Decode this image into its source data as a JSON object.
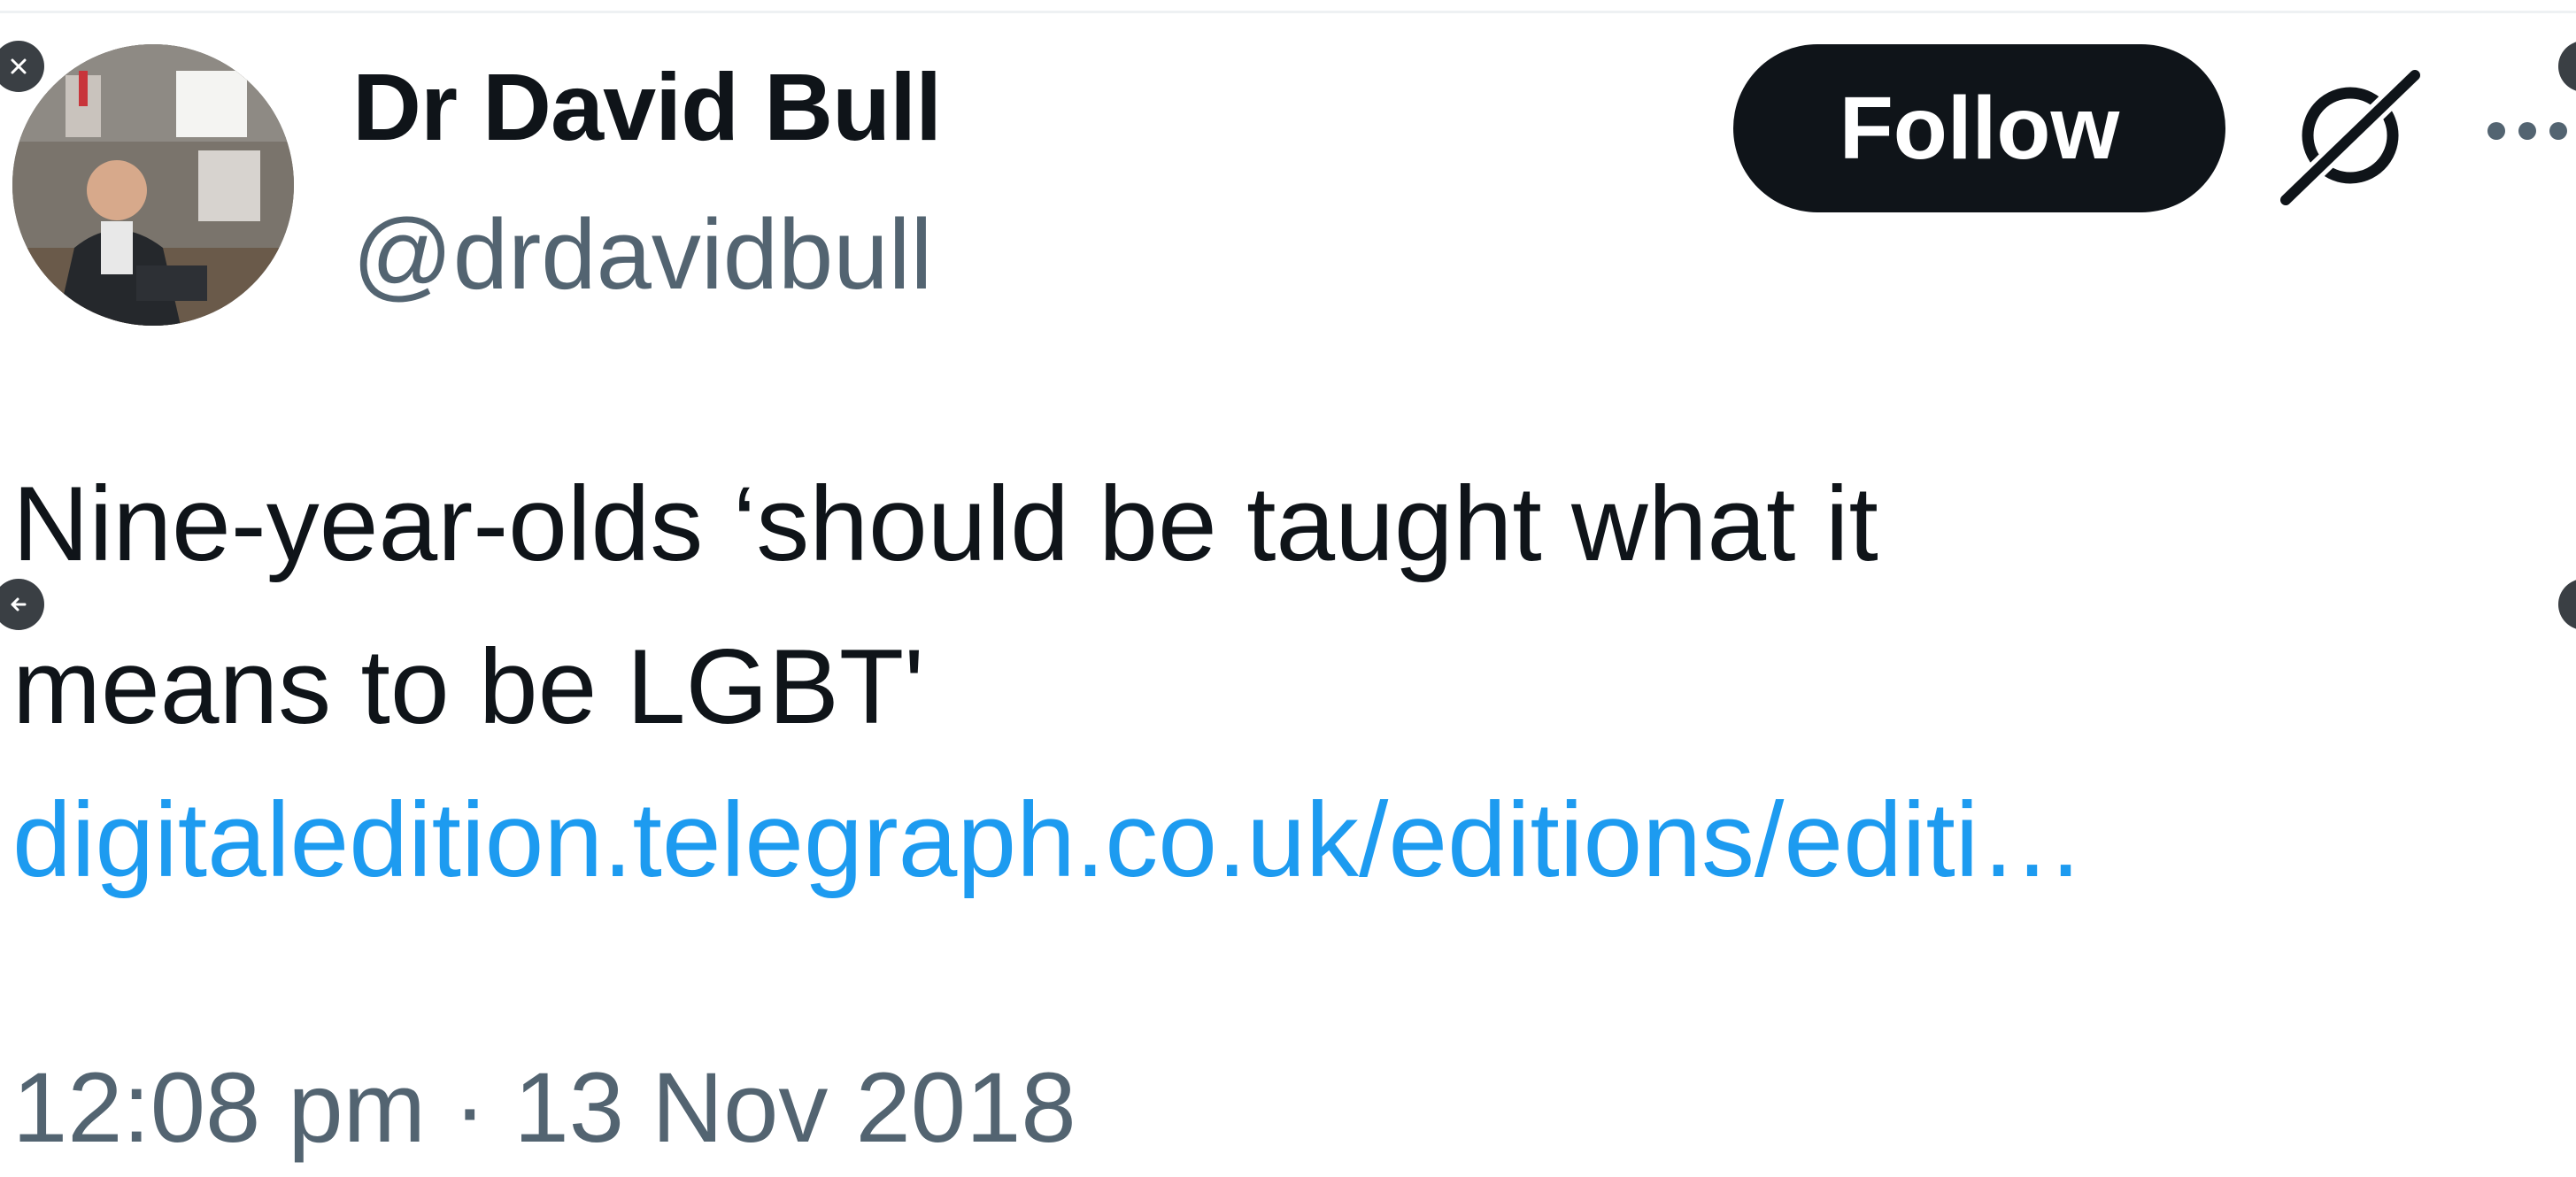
{
  "tweet": {
    "author": {
      "display_name": "Dr David Bull",
      "handle": "@drdavidbull"
    },
    "follow_label": "Follow",
    "text_lines": [
      "Nine-year-olds ‘should be taught what it",
      "means to be LGBT'"
    ],
    "link": "digitaledition.telegraph.co.uk/editions/editi…",
    "timestamp": "12:08 pm · 13 Nov 2018"
  },
  "icons": {
    "grok": "grok-icon",
    "more": "more-icon",
    "close": "close-icon",
    "back": "arrow-left-icon"
  },
  "colors": {
    "text_primary": "#0f1419",
    "text_secondary": "#536471",
    "link": "#1d9bf0",
    "follow_bg": "#0f1419",
    "follow_text": "#ffffff"
  }
}
